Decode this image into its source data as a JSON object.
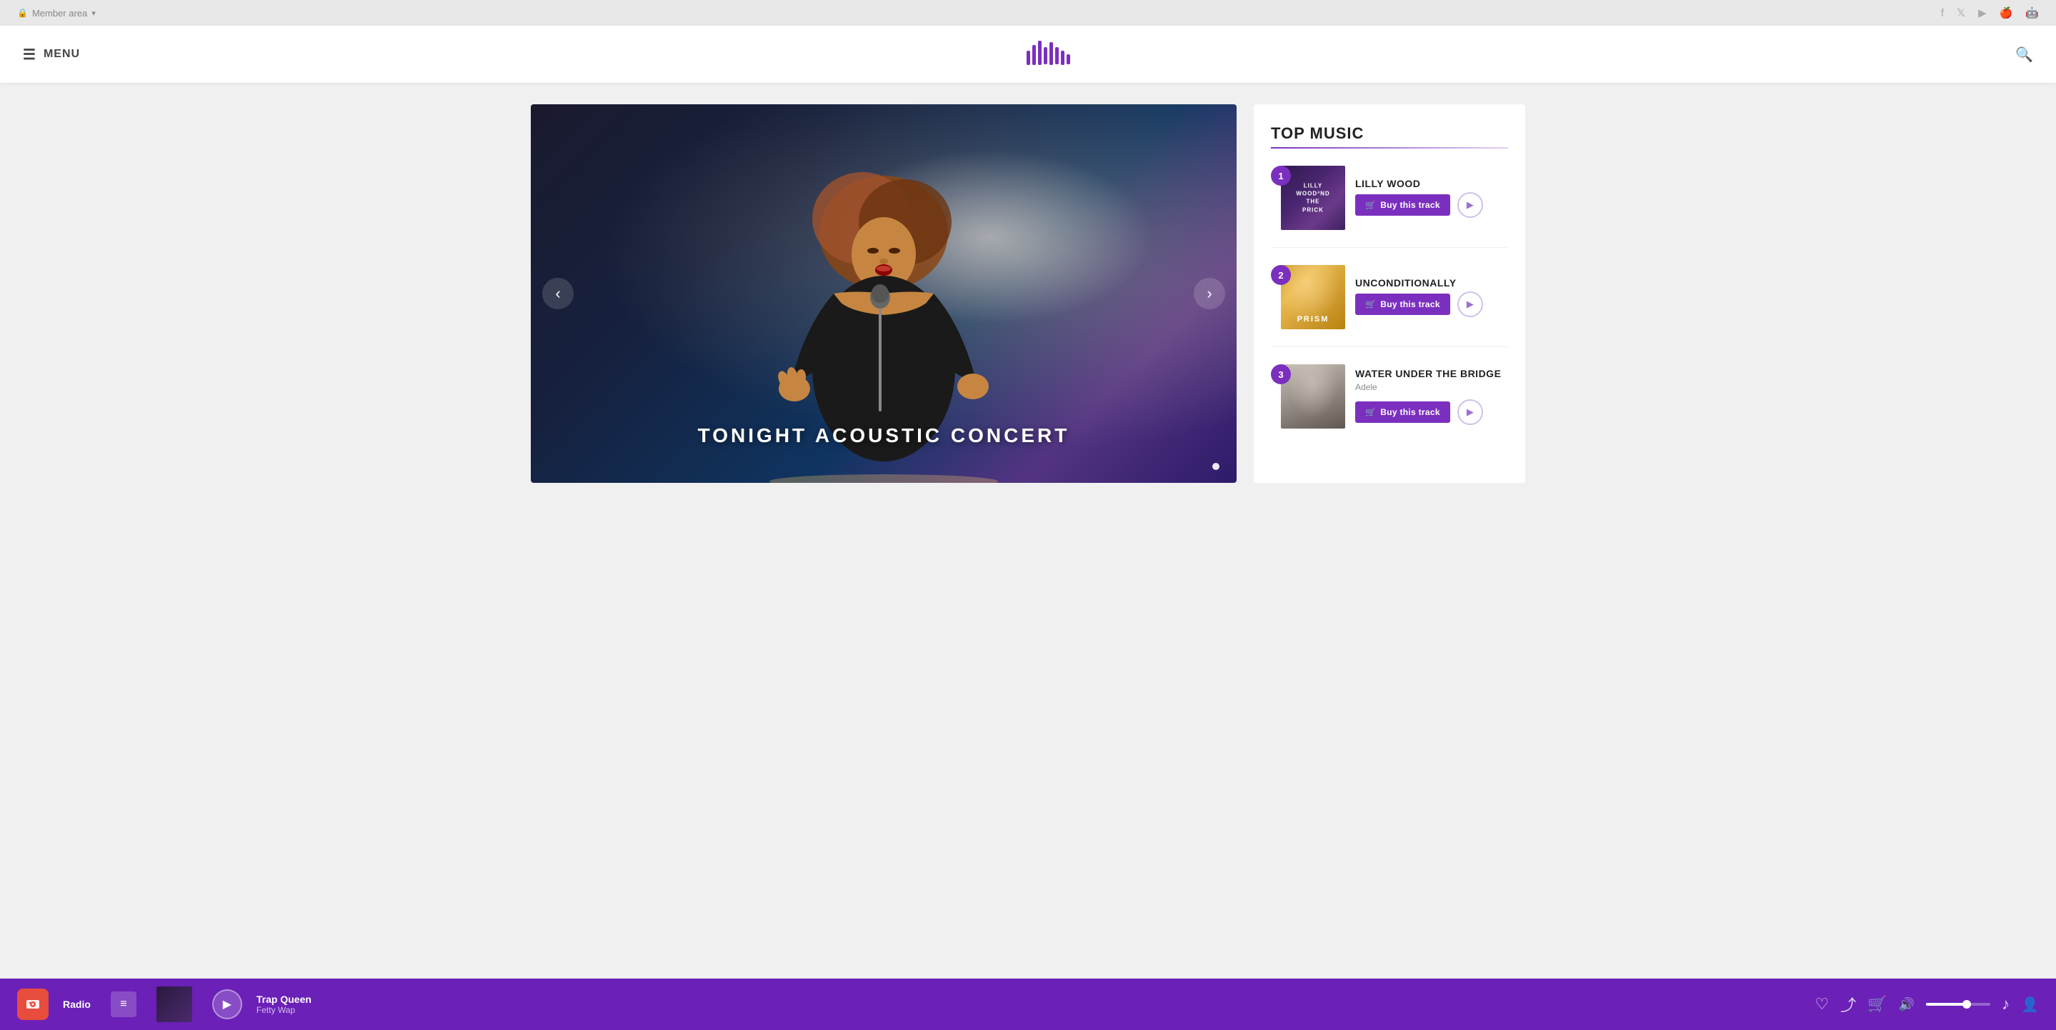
{
  "topbar": {
    "member_area": "Member area",
    "icons": [
      "facebook-icon",
      "twitter-icon",
      "youtube-icon",
      "apple-icon",
      "android-icon"
    ]
  },
  "header": {
    "menu_label": "MENU",
    "logo_alt": "Music Logo"
  },
  "slider": {
    "caption": "TONIGHT ACOUSTIC CONCERT",
    "prev_label": "‹",
    "next_label": "›",
    "dots": [
      true
    ]
  },
  "top_music": {
    "title": "TOP MUSIC",
    "tracks": [
      {
        "number": "1",
        "name": "LILLY WOOD",
        "artist": "",
        "buy_label": "Buy this track",
        "thumb_class": "track-thumb-1"
      },
      {
        "number": "2",
        "name": "UNCONDITIONALLY",
        "artist": "",
        "buy_label": "Buy this track",
        "thumb_class": "track-thumb-2"
      },
      {
        "number": "3",
        "name": "WATER UNDER THE BRIDGE",
        "artist": "Adele",
        "buy_label": "Buy this track",
        "thumb_class": "track-thumb-3"
      }
    ]
  },
  "now_playing": {
    "radio_label": "Radio",
    "track_name": "Trap Queen",
    "track_artist": "Fetty Wap"
  }
}
